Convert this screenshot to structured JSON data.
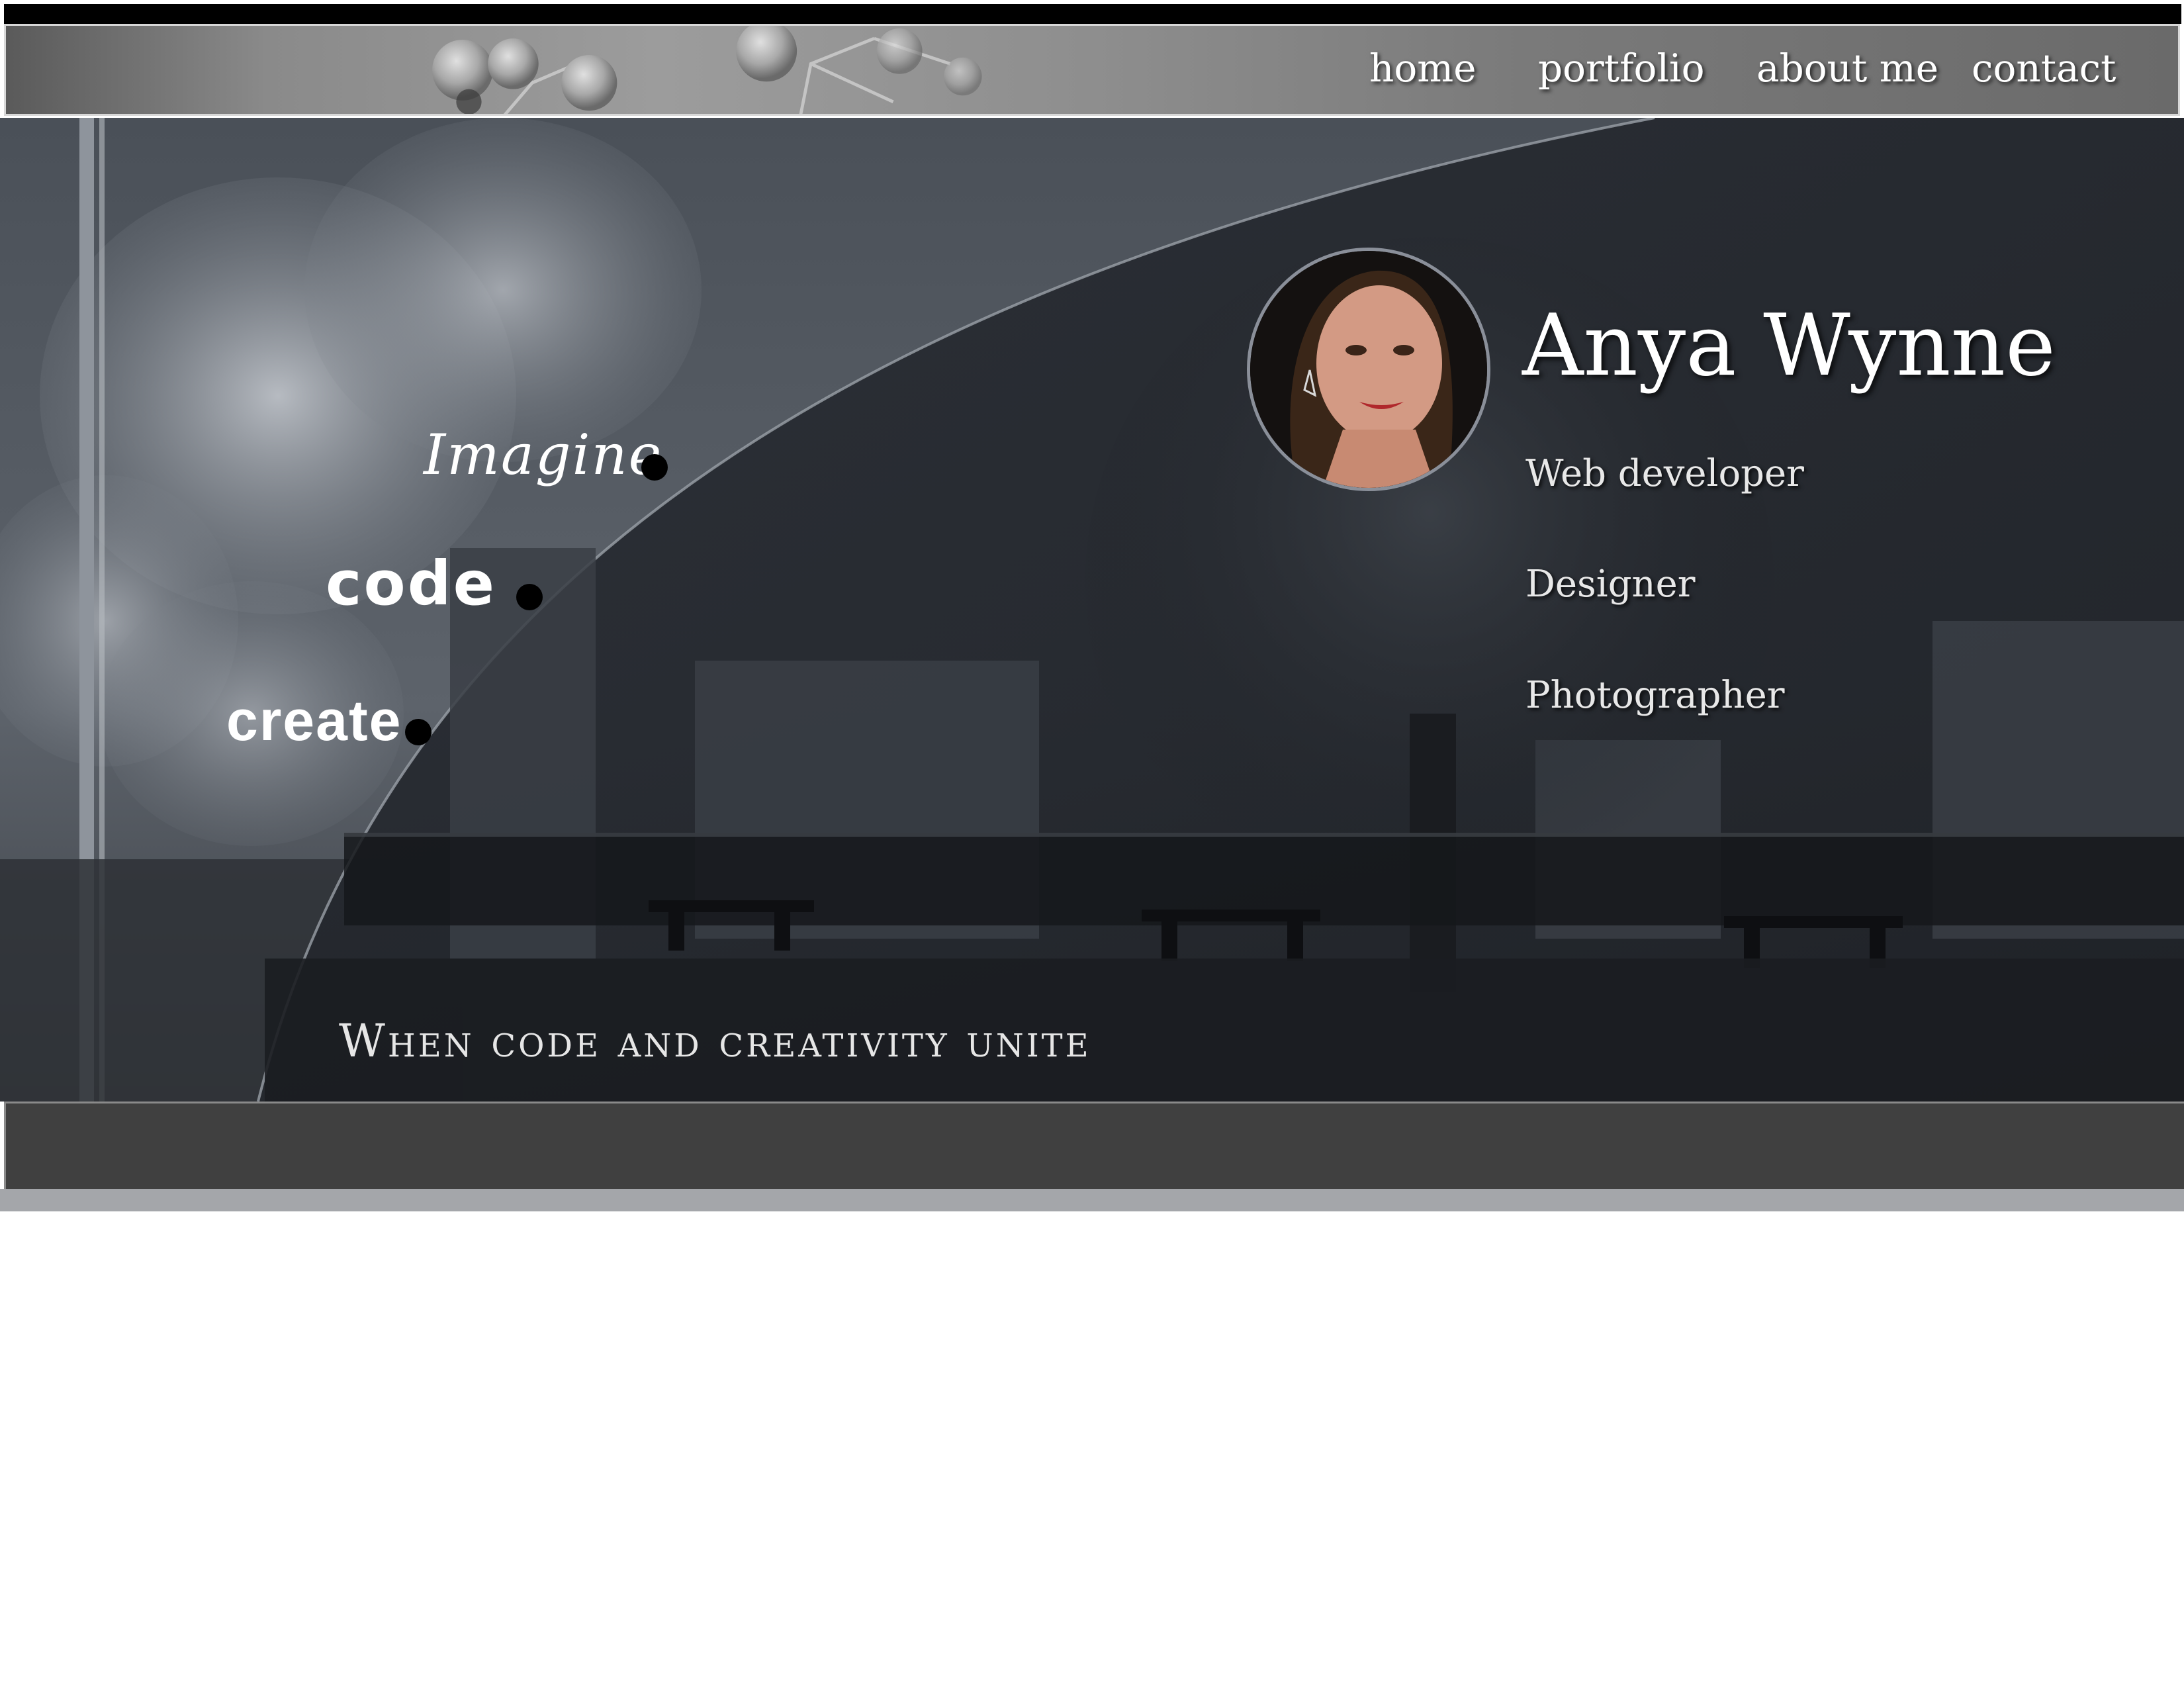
{
  "nav": {
    "items": [
      {
        "label": "home"
      },
      {
        "label": "portfolio"
      },
      {
        "label": "about me"
      },
      {
        "label": "contact"
      }
    ]
  },
  "hero": {
    "words": {
      "imagine": "Imagine",
      "code": "code",
      "create": "create"
    },
    "tagline": "When code and creativity unite"
  },
  "profile": {
    "name": "Anya Wynne",
    "roles": [
      "Web developer",
      "Designer",
      "Photographer"
    ],
    "avatar_icon": "portrait-photo"
  },
  "colors": {
    "top_bar": "#000000",
    "hero_dark": "#20242a",
    "footer_bar": "#404040",
    "footer_strip": "#a4a6aa",
    "text": "#ffffff"
  }
}
